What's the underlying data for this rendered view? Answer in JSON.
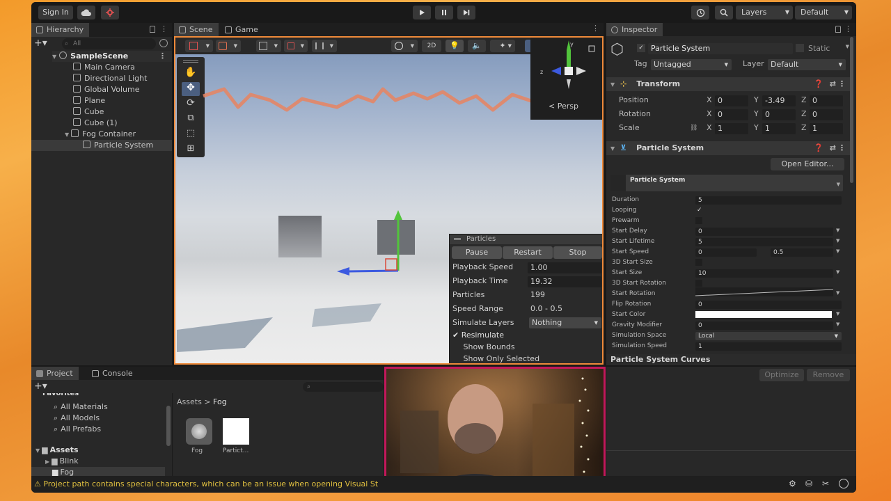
{
  "toolbar": {
    "sign_in": "Sign In",
    "layers": "Layers",
    "layout": "Default"
  },
  "hierarchy": {
    "tab": "Hierarchy",
    "search_placeholder": "All",
    "scene": "SampleScene",
    "items": [
      "Main Camera",
      "Directional Light",
      "Global Volume",
      "Plane",
      "Cube",
      "Cube (1)",
      "Fog Container",
      "Particle System"
    ]
  },
  "scene_view": {
    "tab_scene": "Scene",
    "tab_game": "Game",
    "mode_2d": "2D",
    "persp": "< Persp"
  },
  "particles_overlay": {
    "title": "Particles",
    "pause": "Pause",
    "restart": "Restart",
    "stop": "Stop",
    "rows": [
      {
        "label": "Playback Speed",
        "value": "1.00"
      },
      {
        "label": "Playback Time",
        "value": "19.32"
      },
      {
        "label": "Particles",
        "value": "199"
      },
      {
        "label": "Speed Range",
        "value": "0.0 - 0.5"
      },
      {
        "label": "Simulate Layers",
        "value": "Nothing"
      }
    ],
    "resimulate": "Resimulate",
    "show_bounds": "Show Bounds",
    "show_only_selected": "Show Only Selected"
  },
  "inspector": {
    "tab": "Inspector",
    "object_name": "Particle System",
    "static": "Static",
    "tag_label": "Tag",
    "tag_value": "Untagged",
    "layer_label": "Layer",
    "layer_value": "Default",
    "transform": {
      "title": "Transform",
      "rows": [
        {
          "label": "Position",
          "x": "0",
          "y": "-3.49",
          "z": "0"
        },
        {
          "label": "Rotation",
          "x": "0",
          "y": "0",
          "z": "0"
        },
        {
          "label": "Scale",
          "x": "1",
          "y": "1",
          "z": "1"
        }
      ]
    },
    "ps_component": {
      "title": "Particle System",
      "open_editor": "Open Editor...",
      "module_title": "Particle System",
      "rows": [
        {
          "label": "Duration",
          "value": "5"
        },
        {
          "label": "Looping",
          "value": "✓"
        },
        {
          "label": "Prewarm",
          "value": ""
        },
        {
          "label": "Start Delay",
          "value": "0"
        },
        {
          "label": "Start Lifetime",
          "value": "5"
        },
        {
          "label": "Start Speed",
          "value": "0",
          "value2": "0.5"
        },
        {
          "label": "3D Start Size",
          "value": ""
        },
        {
          "label": "Start Size",
          "value": "10"
        },
        {
          "label": "3D Start Rotation",
          "value": ""
        },
        {
          "label": "Start Rotation",
          "value": ""
        },
        {
          "label": "Flip Rotation",
          "value": "0"
        },
        {
          "label": "Start Color",
          "value": ""
        },
        {
          "label": "Gravity Modifier",
          "value": "0"
        },
        {
          "label": "Simulation Space",
          "value": "Local"
        },
        {
          "label": "Simulation Speed",
          "value": "1"
        }
      ]
    },
    "curves_title": "Particle System Curves",
    "optimize": "Optimize",
    "remove": "Remove"
  },
  "project": {
    "tab_project": "Project",
    "tab_console": "Console",
    "favorites": "Favorites",
    "fav_items": [
      "All Materials",
      "All Models",
      "All Prefabs"
    ],
    "assets": "Assets",
    "asset_folders": [
      "Blink",
      "Fog"
    ],
    "breadcrumb_root": "Assets",
    "breadcrumb_sep": ">",
    "breadcrumb_current": "Fog",
    "files": [
      "Fog",
      "Partict..."
    ]
  },
  "status_bar": {
    "warning": "Project path contains special characters, which can be an issue when opening Visual St"
  },
  "colors": {
    "scene_border": "#ef8a3a",
    "webcam_border": "#c2185b",
    "x_axis": "#d94a3a",
    "y_axis": "#52c43c",
    "z_axis": "#3c5ae0"
  }
}
